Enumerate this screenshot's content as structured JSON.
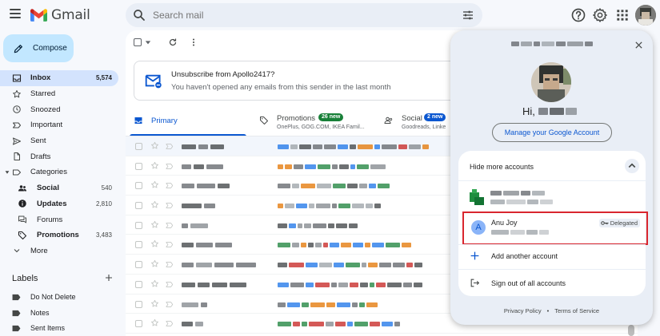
{
  "app": {
    "name": "Gmail"
  },
  "search": {
    "placeholder": "Search mail"
  },
  "compose": {
    "label": "Compose"
  },
  "nav": [
    {
      "label": "Inbox",
      "count": "5,574",
      "icon": "inbox-icon",
      "active": true
    },
    {
      "label": "Starred",
      "count": "",
      "icon": "star-icon"
    },
    {
      "label": "Snoozed",
      "count": "",
      "icon": "clock-icon"
    },
    {
      "label": "Important",
      "count": "",
      "icon": "important-icon"
    },
    {
      "label": "Sent",
      "count": "",
      "icon": "send-icon"
    },
    {
      "label": "Drafts",
      "count": "",
      "icon": "draft-icon"
    },
    {
      "label": "Categories",
      "count": "",
      "icon": "label-icon"
    },
    {
      "label": "Social",
      "count": "540",
      "icon": "social-icon",
      "bold": true
    },
    {
      "label": "Updates",
      "count": "2,810",
      "icon": "info-icon",
      "bold": true
    },
    {
      "label": "Forums",
      "count": "",
      "icon": "forum-icon"
    },
    {
      "label": "Promotions",
      "count": "3,483",
      "icon": "tag-icon",
      "bold": true
    },
    {
      "label": "More",
      "count": "",
      "icon": "chevron-down-icon"
    }
  ],
  "labels": {
    "heading": "Labels",
    "items": [
      "Do Not Delete",
      "Notes",
      "Sent Items"
    ]
  },
  "unsubscribe": {
    "title": "Unsubscribe from Apollo2417?",
    "subtitle": "You haven't opened any emails from this sender in the last month"
  },
  "tabs": [
    {
      "label": "Primary",
      "sub": "",
      "badge": ""
    },
    {
      "label": "Promotions",
      "sub": "OnePlus, GOG.COM, IKEA Famil...",
      "badge": "26 new",
      "badge_color": "#188038"
    },
    {
      "label": "Social",
      "sub": "Goodreads, Linke",
      "badge": "2 new",
      "badge_color": "#0b57d0"
    }
  ],
  "account_menu": {
    "greeting": "Hi,",
    "manage_label": "Manage your Google Account",
    "hide_label": "Hide more accounts",
    "delegated_account": {
      "name": "Anu Joy",
      "initial": "A",
      "badge": "Delegated"
    },
    "add_account_label": "Add another account",
    "sign_out_label": "Sign out of all accounts",
    "privacy_label": "Privacy Policy",
    "separator": "•",
    "terms_label": "Terms of Service"
  },
  "colors": {
    "accent": "#0b57d0",
    "compose_bg": "#c2e7ff",
    "active_nav_bg": "#d3e3fd",
    "highlight_border": "#d9262e"
  }
}
